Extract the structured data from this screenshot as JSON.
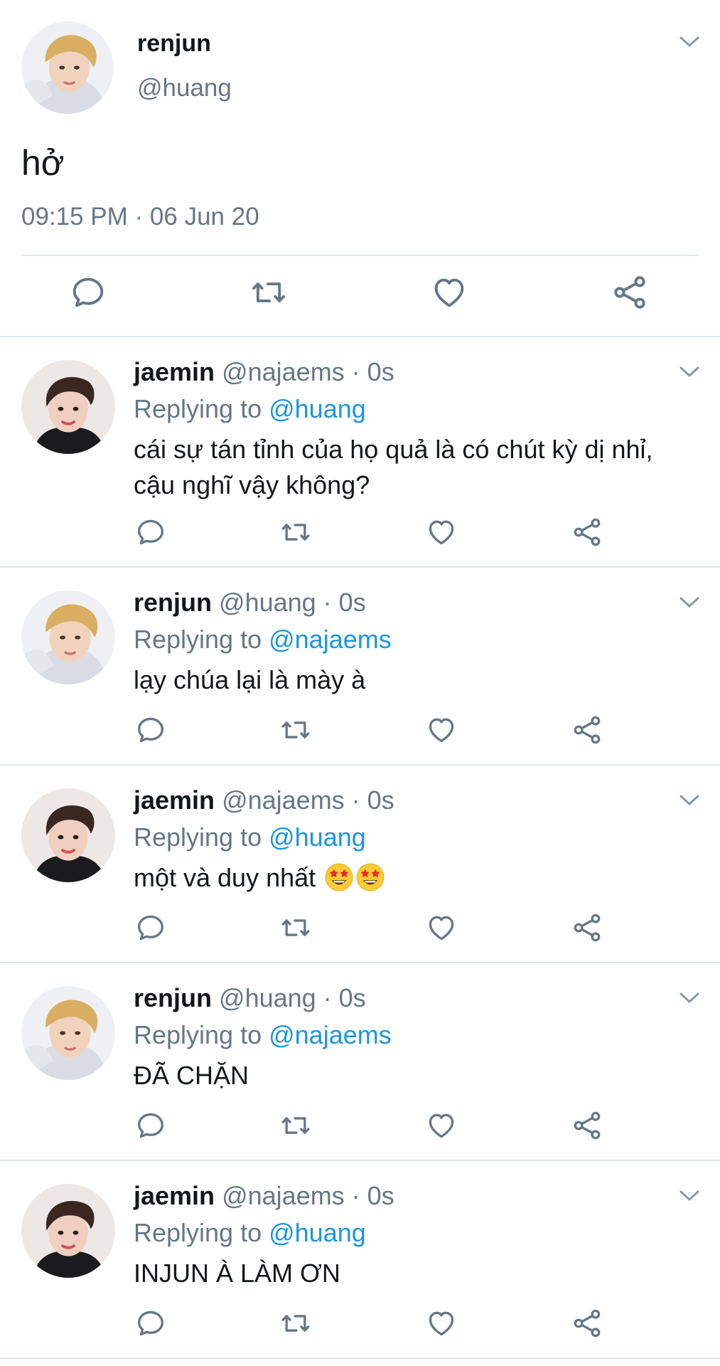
{
  "main_tweet": {
    "name": "renjun",
    "handle": "@huang",
    "text": "hở",
    "timestamp": "09:15 PM · 06 Jun 20"
  },
  "replies": [
    {
      "name": "jaemin",
      "meta": "@najaems · 0s",
      "replying_prefix": "Replying to ",
      "replying_to": "@huang",
      "text": "cái sự tán tỉnh của họ quả là có chút kỳ dị nhỉ, cậu nghĩ vậy không?",
      "avatar": "jaemin"
    },
    {
      "name": "renjun",
      "meta": "@huang · 0s",
      "replying_prefix": "Replying to ",
      "replying_to": "@najaems",
      "text": "lạy chúa lại là mày à",
      "avatar": "renjun"
    },
    {
      "name": "jaemin",
      "meta": "@najaems · 0s",
      "replying_prefix": "Replying to ",
      "replying_to": "@huang",
      "text": "một và duy nhất",
      "emoji": [
        "star-struck-emoji",
        "star-struck-emoji"
      ],
      "avatar": "jaemin"
    },
    {
      "name": "renjun",
      "meta": "@huang · 0s",
      "replying_prefix": "Replying to ",
      "replying_to": "@najaems",
      "text": "ĐÃ CHẶN",
      "avatar": "renjun"
    },
    {
      "name": "jaemin",
      "meta": "@najaems · 0s",
      "replying_prefix": "Replying to ",
      "replying_to": "@huang",
      "text": "INJUN À LÀM ƠN",
      "avatar": "jaemin"
    }
  ],
  "icons": {
    "actions": [
      "reply-icon",
      "retweet-icon",
      "like-icon",
      "share-icon"
    ],
    "menu": "chevron-down-icon"
  },
  "colors": {
    "text": "#14171a",
    "secondary": "#657786",
    "link": "#1b95e0",
    "divider": "#e1e8ed"
  }
}
